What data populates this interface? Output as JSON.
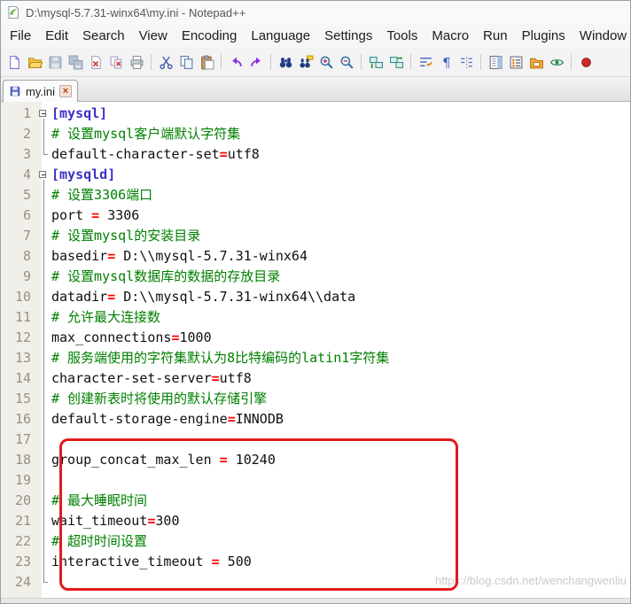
{
  "window": {
    "title": "D:\\mysql-5.7.31-winx64\\my.ini - Notepad++"
  },
  "menu": {
    "items": [
      "File",
      "Edit",
      "Search",
      "View",
      "Encoding",
      "Language",
      "Settings",
      "Tools",
      "Macro",
      "Run",
      "Plugins",
      "Window"
    ]
  },
  "toolbar": {
    "buttons": [
      {
        "icon": "new-file-icon"
      },
      {
        "icon": "open-folder-icon"
      },
      {
        "icon": "save-icon"
      },
      {
        "icon": "save-all-icon"
      },
      {
        "icon": "close-file-icon"
      },
      {
        "icon": "close-all-icon"
      },
      {
        "icon": "print-icon"
      },
      {
        "divider": true
      },
      {
        "icon": "cut-icon"
      },
      {
        "icon": "copy-icon"
      },
      {
        "icon": "paste-icon"
      },
      {
        "divider": true
      },
      {
        "icon": "undo-icon"
      },
      {
        "icon": "redo-icon"
      },
      {
        "divider": true
      },
      {
        "icon": "find-icon"
      },
      {
        "icon": "replace-icon"
      },
      {
        "icon": "zoom-in-icon"
      },
      {
        "icon": "zoom-out-icon"
      },
      {
        "divider": true
      },
      {
        "icon": "sync-v-icon"
      },
      {
        "icon": "sync-h-icon"
      },
      {
        "divider": true
      },
      {
        "icon": "word-wrap-icon"
      },
      {
        "icon": "show-all-chars-icon"
      },
      {
        "icon": "indent-guide-icon"
      },
      {
        "divider": true
      },
      {
        "icon": "doc-map-icon"
      },
      {
        "icon": "function-list-icon"
      },
      {
        "icon": "folder-workspace-icon"
      },
      {
        "icon": "monitoring-icon"
      },
      {
        "divider": true
      },
      {
        "icon": "macro-record-icon"
      }
    ]
  },
  "tabs": [
    {
      "label": "my.ini",
      "state": "saved"
    }
  ],
  "icons": {
    "tab_close": "×"
  },
  "editor": {
    "lines": [
      {
        "num": 1,
        "fold": "box",
        "segs": [
          {
            "t": "[mysql]",
            "c": "sec"
          }
        ]
      },
      {
        "num": 2,
        "fold": "line",
        "segs": [
          {
            "t": "# 设置mysql客户端默认字符集",
            "c": "com"
          }
        ]
      },
      {
        "num": 3,
        "fold": "corner",
        "segs": [
          {
            "t": "default-character-set",
            "c": "txt"
          },
          {
            "t": "=",
            "c": "eq"
          },
          {
            "t": "utf8",
            "c": "txt"
          }
        ]
      },
      {
        "num": 4,
        "fold": "box",
        "segs": [
          {
            "t": "[mysqld]",
            "c": "sec"
          }
        ]
      },
      {
        "num": 5,
        "fold": "line",
        "segs": [
          {
            "t": "# 设置3306端口",
            "c": "com"
          }
        ]
      },
      {
        "num": 6,
        "fold": "line",
        "segs": [
          {
            "t": "port ",
            "c": "txt"
          },
          {
            "t": "=",
            "c": "eq"
          },
          {
            "t": " 3306",
            "c": "txt"
          }
        ]
      },
      {
        "num": 7,
        "fold": "line",
        "segs": [
          {
            "t": "# 设置mysql的安装目录",
            "c": "com"
          }
        ]
      },
      {
        "num": 8,
        "fold": "line",
        "segs": [
          {
            "t": "basedir",
            "c": "txt"
          },
          {
            "t": "=",
            "c": "eq"
          },
          {
            "t": " D:\\\\mysql-5.7.31-winx64",
            "c": "txt"
          }
        ]
      },
      {
        "num": 9,
        "fold": "line",
        "segs": [
          {
            "t": "# 设置mysql数据库的数据的存放目录",
            "c": "com"
          }
        ]
      },
      {
        "num": 10,
        "fold": "line",
        "segs": [
          {
            "t": "datadir",
            "c": "txt"
          },
          {
            "t": "=",
            "c": "eq"
          },
          {
            "t": " D:\\\\mysql-5.7.31-winx64\\\\data",
            "c": "txt"
          }
        ]
      },
      {
        "num": 11,
        "fold": "line",
        "segs": [
          {
            "t": "# 允许最大连接数",
            "c": "com"
          }
        ]
      },
      {
        "num": 12,
        "fold": "line",
        "segs": [
          {
            "t": "max_connections",
            "c": "txt"
          },
          {
            "t": "=",
            "c": "eq"
          },
          {
            "t": "1000",
            "c": "txt"
          }
        ]
      },
      {
        "num": 13,
        "fold": "line",
        "segs": [
          {
            "t": "# 服务端使用的字符集默认为8比特编码的latin1字符集",
            "c": "com"
          }
        ]
      },
      {
        "num": 14,
        "fold": "line",
        "segs": [
          {
            "t": "character-set-server",
            "c": "txt"
          },
          {
            "t": "=",
            "c": "eq"
          },
          {
            "t": "utf8",
            "c": "txt"
          }
        ]
      },
      {
        "num": 15,
        "fold": "line",
        "segs": [
          {
            "t": "# 创建新表时将使用的默认存储引擎",
            "c": "com"
          }
        ]
      },
      {
        "num": 16,
        "fold": "line",
        "segs": [
          {
            "t": "default-storage-engine",
            "c": "txt"
          },
          {
            "t": "=",
            "c": "eq"
          },
          {
            "t": "INNODB",
            "c": "txt"
          }
        ]
      },
      {
        "num": 17,
        "fold": "line",
        "segs": []
      },
      {
        "num": 18,
        "fold": "line",
        "segs": [
          {
            "t": "group_concat_max_len ",
            "c": "txt"
          },
          {
            "t": "=",
            "c": "eq"
          },
          {
            "t": " 10240",
            "c": "txt"
          }
        ]
      },
      {
        "num": 19,
        "fold": "line",
        "segs": []
      },
      {
        "num": 20,
        "fold": "line",
        "segs": [
          {
            "t": "# 最大睡眠时间",
            "c": "com"
          }
        ]
      },
      {
        "num": 21,
        "fold": "line",
        "segs": [
          {
            "t": "wait_timeout",
            "c": "txt"
          },
          {
            "t": "=",
            "c": "eq"
          },
          {
            "t": "300",
            "c": "txt"
          }
        ]
      },
      {
        "num": 22,
        "fold": "line",
        "segs": [
          {
            "t": "# 超时时间设置",
            "c": "com"
          }
        ]
      },
      {
        "num": 23,
        "fold": "line",
        "segs": [
          {
            "t": "interactive_timeout ",
            "c": "txt"
          },
          {
            "t": "=",
            "c": "eq"
          },
          {
            "t": " 500",
            "c": "txt"
          }
        ]
      },
      {
        "num": 24,
        "fold": "corner",
        "segs": []
      }
    ]
  },
  "watermark": {
    "text": "https://blog.csdn.net/wenchangwenliu"
  },
  "colors": {
    "section": "#3b30c8",
    "comment": "#008000",
    "equals": "#ff0000",
    "annotation": "#e31b1b",
    "margin_bg": "#f1efe9",
    "line_number": "#98917e"
  }
}
